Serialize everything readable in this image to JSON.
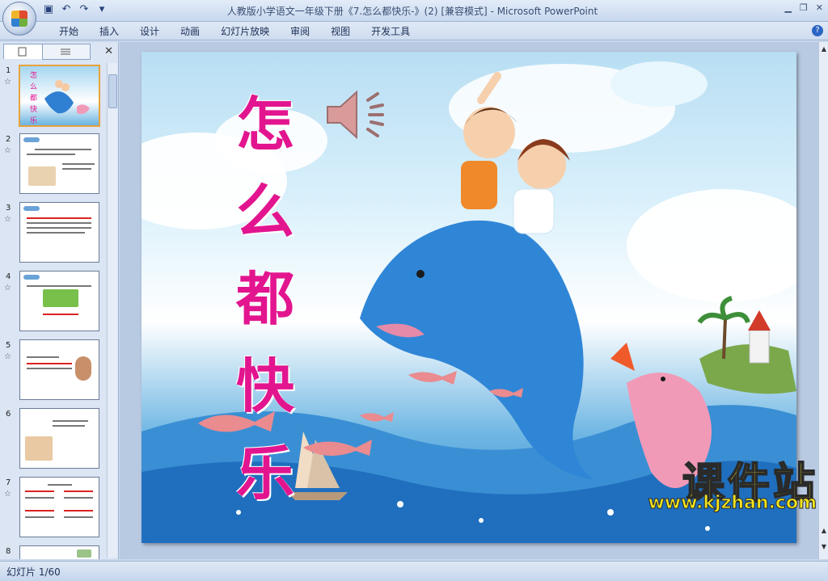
{
  "window": {
    "title": "人教版小学语文一年级下册《7.怎么都快乐-》(2) [兼容模式] - Microsoft PowerPoint",
    "controls": [
      "▁",
      "❐",
      "✕"
    ]
  },
  "menu": [
    "开始",
    "插入",
    "设计",
    "动画",
    "幻灯片放映",
    "审阅",
    "视图",
    "开发工具"
  ],
  "panel": {
    "thumbnails": [
      {
        "num": "1",
        "star": "☆"
      },
      {
        "num": "2",
        "star": "☆"
      },
      {
        "num": "3",
        "star": "☆"
      },
      {
        "num": "4",
        "star": "☆"
      },
      {
        "num": "5",
        "star": "☆"
      },
      {
        "num": "6",
        "star": ""
      },
      {
        "num": "7",
        "star": "☆"
      },
      {
        "num": "8",
        "star": ""
      }
    ]
  },
  "slide": {
    "title_chars": [
      "怎",
      "么",
      "都",
      "快",
      "乐"
    ],
    "watermark_cn": "课件站",
    "watermark_en": "www.kjzhan.com"
  },
  "status": {
    "slide_indicator": "幻灯片 1/60"
  },
  "colors": {
    "title_magenta": "#e2158f",
    "watermark_yellow": "#f4e51d",
    "ribbon_bg": "#dfe9f6"
  },
  "icons": [
    "office-button-icon",
    "save-icon",
    "undo-icon",
    "redo-icon",
    "customize-qat-icon",
    "help-icon",
    "speaker-icon",
    "close-icon"
  ]
}
